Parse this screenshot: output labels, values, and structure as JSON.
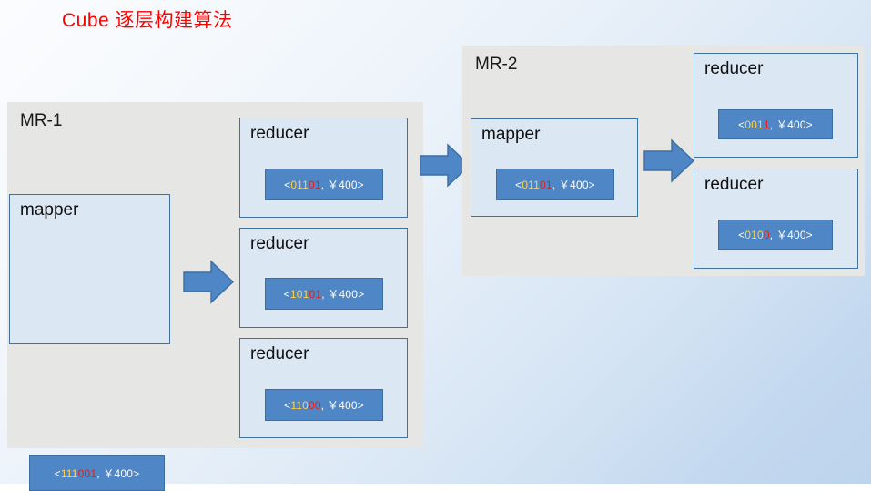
{
  "title": "Cube 逐层构建算法",
  "colors": {
    "title": "#ff0000",
    "stage_bg": "#e6e6e4",
    "node_bg": "#dce7f4",
    "node_border": "#41719c",
    "chip_bg": "#4f86c6",
    "chip_border": "#3a6ea5",
    "key_highlight": "#ffd24d",
    "key_drop": "#e02020",
    "arrow_fill": "#4f86c6",
    "arrow_border": "#3a6ea5",
    "canvas_bg_start": "#fbfcfe",
    "canvas_bg_end": "#bdd4ed"
  },
  "stages": [
    {
      "id": "mr-1",
      "label": "MR-1",
      "mapper": {
        "label": "mapper",
        "chip": {
          "open": "<",
          "key_kept": "111",
          "key_dropped": "001",
          "close": ", ￥400>",
          "full_text": "<111001, ￥400>"
        }
      },
      "reducers": [
        {
          "label": "reducer",
          "chip": {
            "open": "<",
            "key_kept": "011",
            "key_dropped": "01",
            "close": ", ￥400>",
            "full_text": "<01101, ￥400>"
          }
        },
        {
          "label": "reducer",
          "chip": {
            "open": "<",
            "key_kept": "101",
            "key_dropped": "01",
            "close": ", ￥400>",
            "full_text": "<10101, ￥400>"
          }
        },
        {
          "label": "reducer",
          "chip": {
            "open": "<",
            "key_kept": "110",
            "key_dropped": "00",
            "close": ", ￥400>",
            "full_text": "<11000, ￥400>"
          }
        }
      ]
    },
    {
      "id": "mr-2",
      "label": "MR-2",
      "mapper": {
        "label": "mapper",
        "chip": {
          "open": "<",
          "key_kept": "011",
          "key_dropped": "01",
          "close": ", ￥400>",
          "full_text": "<01101, ￥400>"
        }
      },
      "reducers": [
        {
          "label": "reducer",
          "chip": {
            "open": "<",
            "key_kept": "001",
            "key_dropped": "1",
            "close": ", ￥400>",
            "full_text": "<0011, ￥400>"
          }
        },
        {
          "label": "reducer",
          "chip": {
            "open": "<",
            "key_kept": "010",
            "key_dropped": "0",
            "close": ", ￥400>",
            "full_text": "<0100, ￥400>"
          }
        }
      ]
    }
  ],
  "arrows": [
    {
      "id": "arrow-mr1-mapper-to-reducers",
      "direction": "right"
    },
    {
      "id": "arrow-mr1-to-mr2",
      "direction": "right"
    },
    {
      "id": "arrow-mr2-mapper-to-reducers",
      "direction": "right"
    }
  ]
}
